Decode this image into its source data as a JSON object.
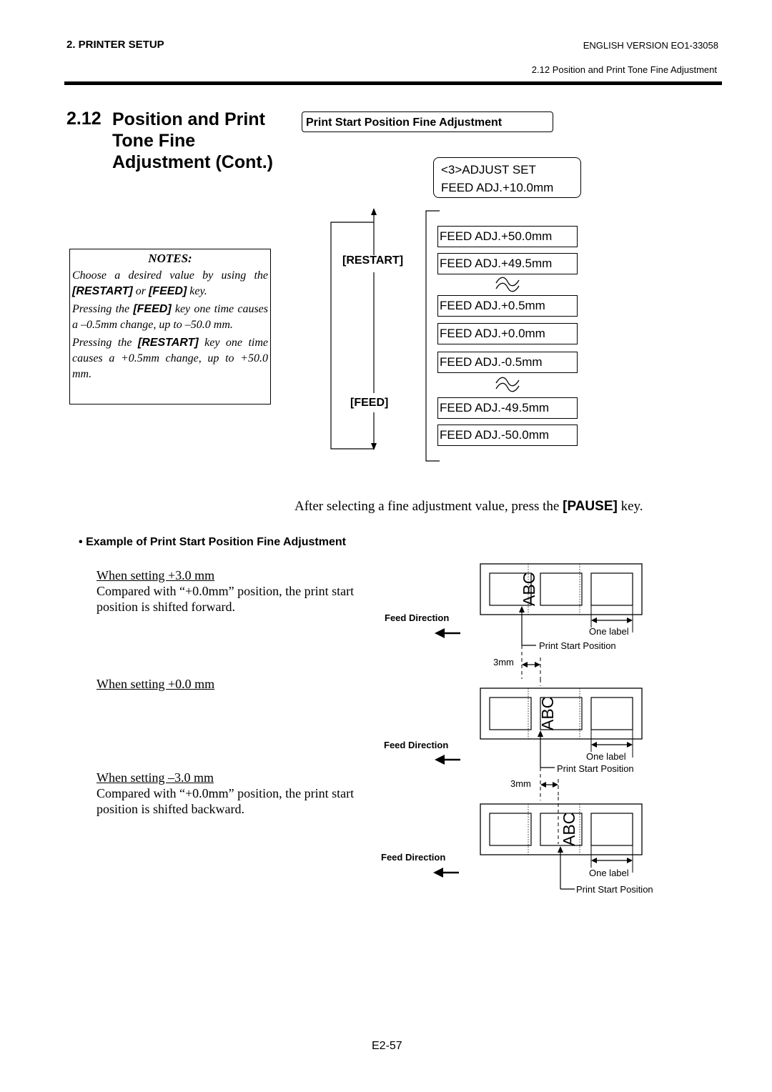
{
  "header": {
    "section": "2. PRINTER SETUP",
    "version": "ENGLISH VERSION EO1-33058",
    "subsection": "2.12 Position and Print Tone Fine Adjustment"
  },
  "title": {
    "number": "2.12",
    "lines": [
      "Position and Print",
      "Tone Fine",
      "Adjustment (Cont.)"
    ]
  },
  "section_box": "Print Start Position Fine Adjustment",
  "adjust_display": {
    "line1": "<3>ADJUST SET",
    "line2": "FEED ADJ.+10.0mm"
  },
  "notes": {
    "title": "NOTES:",
    "p1_pre": "Choose a desired value by using the ",
    "p1_key1": "[RESTART]",
    "p1_mid": " or ",
    "p1_key2": "[FEED]",
    "p1_post": " key.",
    "p2_pre": "Pressing the ",
    "p2_key": "[FEED]",
    "p2_post": " key one time causes a –0.5mm change, up to –50.0 mm.",
    "p3_pre": "Pressing the ",
    "p3_key": "[RESTART]",
    "p3_post": " key one time causes a +0.5mm change, up to +50.0 mm."
  },
  "keys": {
    "restart": "[RESTART]",
    "feed": "[FEED]"
  },
  "feed_values": [
    "FEED ADJ.+50.0mm",
    "FEED ADJ.+49.5mm",
    "FEED ADJ.+0.5mm",
    "FEED ADJ.+0.0mm",
    "FEED ADJ.-0.5mm",
    "FEED ADJ.-49.5mm",
    "FEED ADJ.-50.0mm"
  ],
  "pause_line": {
    "pre": "After selecting a fine adjustment value, press the ",
    "key": "[PAUSE]",
    "post": " key."
  },
  "example": {
    "heading": "Example of Print Start Position Fine Adjustment",
    "cases": [
      {
        "setting": "When setting +3.0 mm",
        "desc1": "Compared with “+0.0mm” position, the print start",
        "desc2": "position is shifted forward."
      },
      {
        "setting": "When setting +0.0 mm",
        "desc1": "",
        "desc2": ""
      },
      {
        "setting": "When setting –3.0 mm",
        "desc1": "Compared with “+0.0mm” position, the print start",
        "desc2": "position is shifted backward."
      }
    ],
    "diagram": {
      "feed_direction": "Feed Direction",
      "one_label": "One label",
      "print_start": "Print Start Position",
      "offset": "3mm",
      "print_text": "ABC"
    }
  },
  "page_number": "E2-57"
}
